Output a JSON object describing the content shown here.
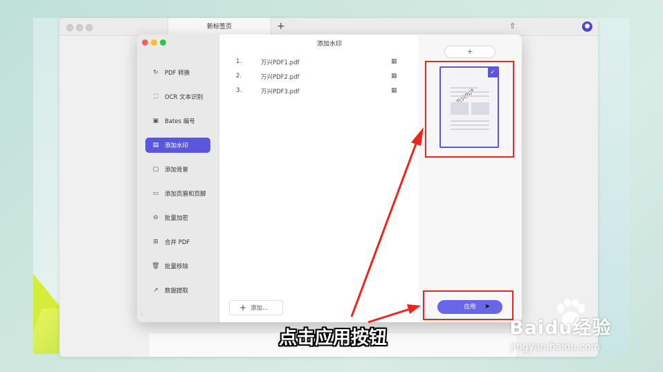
{
  "browser": {
    "tab_title": "新标签页",
    "new_tab_symbol": "+"
  },
  "app": {
    "title": "添加水印",
    "sidebar": {
      "items": [
        {
          "icon": "convert-icon",
          "label": "PDF 转换",
          "active": false
        },
        {
          "icon": "scan-icon",
          "label": "OCR 文本识别",
          "active": false
        },
        {
          "icon": "bates-icon",
          "label": "Bates 编号",
          "active": false
        },
        {
          "icon": "watermark-icon",
          "label": "添加水印",
          "active": true
        },
        {
          "icon": "background-icon",
          "label": "添加背景",
          "active": false
        },
        {
          "icon": "header-footer-icon",
          "label": "添加页眉和页脚",
          "active": false
        },
        {
          "icon": "lock-icon",
          "label": "批量加密",
          "active": false
        },
        {
          "icon": "merge-icon",
          "label": "合并 PDF",
          "active": false
        },
        {
          "icon": "trash-icon",
          "label": "批量移除",
          "active": false
        },
        {
          "icon": "extract-icon",
          "label": "数据提取",
          "active": false
        }
      ]
    },
    "files": [
      {
        "num": "1.",
        "name": "万兴PDF1.pdf"
      },
      {
        "num": "2.",
        "name": "万兴PDF2.pdf"
      },
      {
        "num": "3.",
        "name": "万兴PDF3.pdf"
      }
    ],
    "add_button_label": "添加...",
    "template_add_symbol": "+",
    "template_watermark_text": "万兴PDF",
    "template_selected": true,
    "apply_button_label": "应用"
  },
  "overlay": {
    "caption": "点击应用按钮",
    "watermark_brand": "Baidu经验",
    "watermark_url": "jingyan.baidu.com",
    "annotation_color": "#f2231a"
  },
  "colors": {
    "accent": "#5b56e0"
  }
}
